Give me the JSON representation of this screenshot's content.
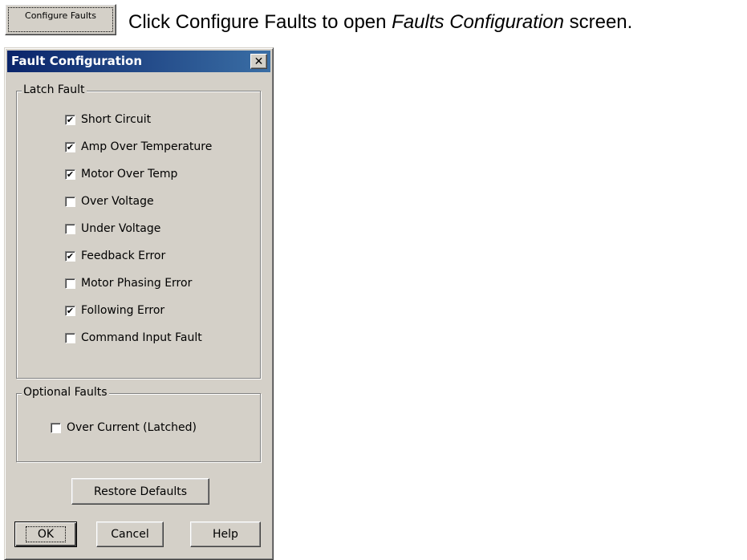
{
  "instruction": {
    "button_label": "Configure Faults",
    "text_before": "Click Configure Faults to open ",
    "text_italic": "Faults Configuration",
    "text_after": " screen."
  },
  "dialog": {
    "title": "Fault Configuration",
    "close_symbol": "✕",
    "latch_group": {
      "label": "Latch Fault",
      "items": [
        {
          "label": "Short Circuit",
          "checked": true
        },
        {
          "label": "Amp Over Temperature",
          "checked": true
        },
        {
          "label": "Motor Over Temp",
          "checked": true
        },
        {
          "label": "Over Voltage",
          "checked": false
        },
        {
          "label": "Under Voltage",
          "checked": false
        },
        {
          "label": "Feedback Error",
          "checked": true
        },
        {
          "label": "Motor Phasing Error",
          "checked": false
        },
        {
          "label": "Following Error",
          "checked": true
        },
        {
          "label": "Command Input Fault",
          "checked": false
        }
      ]
    },
    "optional_group": {
      "label": "Optional Faults",
      "items": [
        {
          "label": "Over Current (Latched)",
          "checked": false
        }
      ]
    },
    "restore_label": "Restore Defaults",
    "ok_label": "OK",
    "cancel_label": "Cancel",
    "help_label": "Help"
  }
}
